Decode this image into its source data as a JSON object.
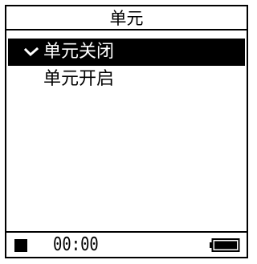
{
  "header": {
    "title": "单元"
  },
  "menu": {
    "items": [
      {
        "label": "单元关闭",
        "selected": true,
        "checked": true
      },
      {
        "label": "单元开启",
        "selected": false,
        "checked": false
      }
    ]
  },
  "status": {
    "playback_icon": "stop-icon",
    "time": "00:00",
    "battery_icon": "battery-icon",
    "battery_level": 1.0
  },
  "colors": {
    "foreground": "#000000",
    "background": "#ffffff"
  }
}
